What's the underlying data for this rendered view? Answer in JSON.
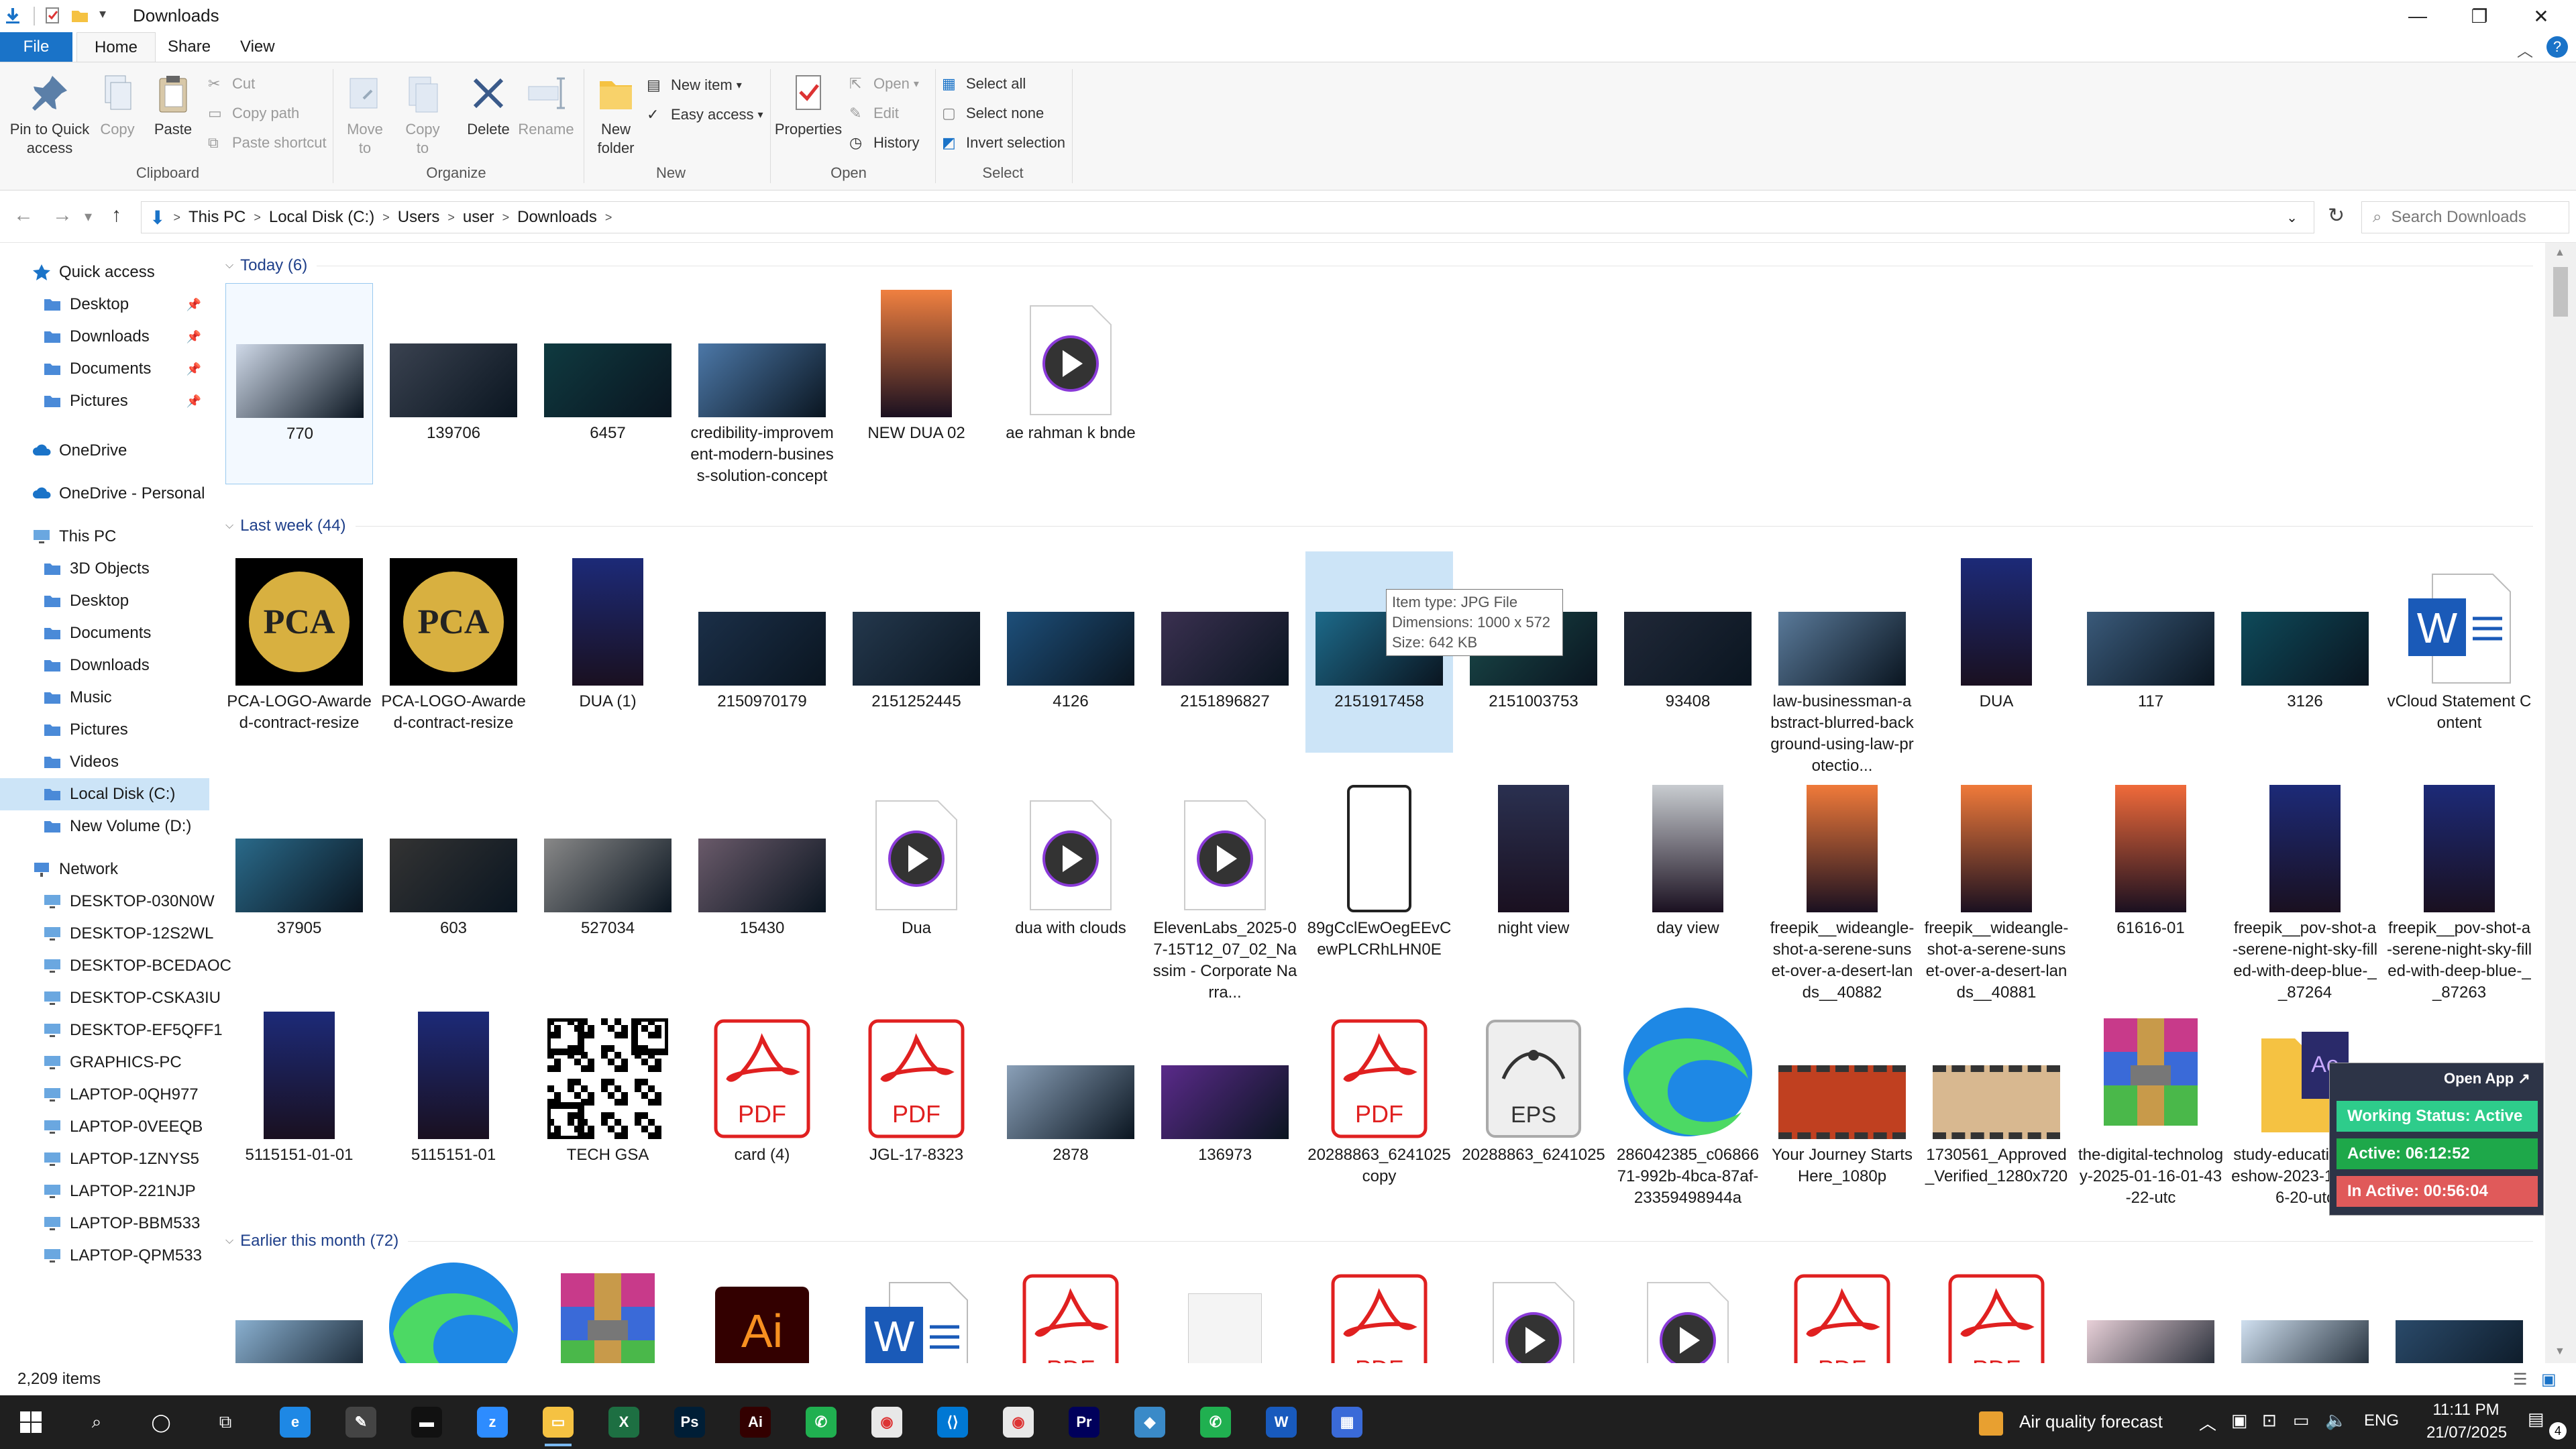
{
  "window": {
    "title": "Downloads"
  },
  "title_controls": {
    "minimize": "—",
    "maximize": "❐",
    "close": "✕"
  },
  "tabs": {
    "file": "File",
    "home": "Home",
    "share": "Share",
    "view": "View"
  },
  "ribbon": {
    "pin": "Pin to Quick access",
    "copy": "Copy",
    "paste": "Paste",
    "cut": "Cut",
    "copy_path": "Copy path",
    "paste_shortcut": "Paste shortcut",
    "move_to": "Move to",
    "copy_to": "Copy to",
    "delete": "Delete",
    "rename": "Rename",
    "new_folder": "New folder",
    "new_item": "New item",
    "easy_access": "Easy access",
    "properties": "Properties",
    "open": "Open",
    "edit": "Edit",
    "history": "History",
    "select_all": "Select all",
    "select_none": "Select none",
    "invert_selection": "Invert selection",
    "groups": {
      "clipboard": "Clipboard",
      "organize": "Organize",
      "new": "New",
      "open": "Open",
      "select": "Select"
    }
  },
  "address": {
    "crumbs": [
      "This PC",
      "Local Disk (C:)",
      "Users",
      "user",
      "Downloads"
    ],
    "sep": ">",
    "search_placeholder": "Search Downloads"
  },
  "nav": {
    "quick_access": "Quick access",
    "quick": [
      "Desktop",
      "Downloads",
      "Documents",
      "Pictures"
    ],
    "onedrive": "OneDrive",
    "onedrive_personal": "OneDrive - Personal",
    "this_pc": "This PC",
    "pc_items": [
      "3D Objects",
      "Desktop",
      "Documents",
      "Downloads",
      "Music",
      "Pictures",
      "Videos",
      "Local Disk (C:)",
      "New Volume (D:)"
    ],
    "network": "Network",
    "network_items": [
      "DESKTOP-030N0W",
      "DESKTOP-12S2WL",
      "DESKTOP-BCEDAOC",
      "DESKTOP-CSKA3IU",
      "DESKTOP-EF5QFF1",
      "GRAPHICS-PC",
      "LAPTOP-0QH977",
      "LAPTOP-0VEEQB",
      "LAPTOP-1ZNYS5",
      "LAPTOP-221NJP",
      "LAPTOP-BBM533",
      "LAPTOP-QPM533"
    ]
  },
  "groups": {
    "today": "Today (6)",
    "last_week": "Last week (44)",
    "earlier": "Earlier this month (72)"
  },
  "today_files": [
    {
      "name": "770",
      "kind": "photo",
      "color": "#cfd9e8"
    },
    {
      "name": "139706",
      "kind": "photo",
      "color": "#3a4250"
    },
    {
      "name": "6457",
      "kind": "photo",
      "color": "#0f3a40"
    },
    {
      "name": "credibility-improvement-modern-business-solution-concept",
      "kind": "photo",
      "color": "#4c78a8"
    },
    {
      "name": "NEW  DUA  02",
      "kind": "tall",
      "color": "#f08040"
    },
    {
      "name": "ae rahman k bnde",
      "kind": "video"
    }
  ],
  "week_row1": [
    {
      "name": "PCA-LOGO-Awarded-contract-resize",
      "kind": "pca"
    },
    {
      "name": "PCA-LOGO-Awarded-contract-resize",
      "kind": "pca"
    },
    {
      "name": "DUA  (1)",
      "kind": "tall",
      "color": "#1c2a78"
    },
    {
      "name": "2150970179",
      "kind": "photo",
      "color": "#1b2f48"
    },
    {
      "name": "2151252445",
      "kind": "photo",
      "color": "#24384d"
    },
    {
      "name": "4126",
      "kind": "photo",
      "color": "#1d4f7a"
    },
    {
      "name": "2151896827",
      "kind": "photo",
      "color": "#3a3050"
    },
    {
      "name": "2151917458",
      "kind": "photo",
      "color": "#1d6a8a"
    },
    {
      "name": "2151003753",
      "kind": "photo",
      "color": "#1a4a4a"
    },
    {
      "name": "93408",
      "kind": "photo",
      "color": "#202838"
    },
    {
      "name": "law-businessman-abstract-blurred-background-using-law-protectio...",
      "kind": "photo",
      "color": "#5a7a9a"
    },
    {
      "name": "DUA",
      "kind": "tall",
      "color": "#1c2a78"
    },
    {
      "name": "117",
      "kind": "photo",
      "color": "#3a5a7a"
    },
    {
      "name": "3126",
      "kind": "photo",
      "color": "#0e4a5a"
    },
    {
      "name": "vCloud Statement Content",
      "kind": "word"
    }
  ],
  "week_row2": [
    {
      "name": "37905",
      "kind": "photo",
      "color": "#2a6a8a"
    },
    {
      "name": "603",
      "kind": "photo",
      "color": "#333333"
    },
    {
      "name": "527034",
      "kind": "photo",
      "color": "#888888"
    },
    {
      "name": "15430",
      "kind": "photo",
      "color": "#6a5a6a"
    },
    {
      "name": "Dua",
      "kind": "video"
    },
    {
      "name": "dua with clouds",
      "kind": "video"
    },
    {
      "name": "ElevenLabs_2025-07-15T12_07_02_Nassim - Corporate Narra...",
      "kind": "video"
    },
    {
      "name": "89gCclEwOegEEvCewPLCRhLHN0E",
      "kind": "phone"
    },
    {
      "name": "night view",
      "kind": "tall",
      "color": "#2a3050"
    },
    {
      "name": "day view",
      "kind": "tall",
      "color": "#c8ccd0"
    },
    {
      "name": "freepik__wideangle-shot-a-serene-sunset-over-a-desert-lands__40882",
      "kind": "tall",
      "color": "#f07a3a"
    },
    {
      "name": "freepik__wideangle-shot-a-serene-sunset-over-a-desert-lands__40881",
      "kind": "tall",
      "color": "#f07a3a"
    },
    {
      "name": "61616-01",
      "kind": "tall",
      "color": "#f06a3a"
    },
    {
      "name": "freepik__pov-shot-a-serene-night-sky-filled-with-deep-blue-__87264",
      "kind": "tall",
      "color": "#1c2a78"
    },
    {
      "name": "freepik__pov-shot-a-serene-night-sky-filled-with-deep-blue-__87263",
      "kind": "tall",
      "color": "#1c2a78"
    }
  ],
  "week_row3": [
    {
      "name": "5115151-01-01",
      "kind": "tall",
      "color": "#1c2a78"
    },
    {
      "name": "5115151-01",
      "kind": "tall",
      "color": "#1c2a78"
    },
    {
      "name": "TECH GSA",
      "kind": "qr"
    },
    {
      "name": "card (4)",
      "kind": "pdf"
    },
    {
      "name": "JGL-17-8323",
      "kind": "pdf"
    },
    {
      "name": "2878",
      "kind": "photo",
      "color": "#8aa0b8"
    },
    {
      "name": "136973",
      "kind": "photo",
      "color": "#5a2a8a"
    },
    {
      "name": "20288863_6241025 copy",
      "kind": "pdf"
    },
    {
      "name": "20288863_6241025",
      "kind": "eps"
    },
    {
      "name": "2860423­85_c0686671-992b-4bca-87af-23359498944a",
      "kind": "edge"
    },
    {
      "name": "Your Journey Starts Here_1080p",
      "kind": "film",
      "color": "#c04020"
    },
    {
      "name": "1730561_Approved_Verified_1280x720",
      "kind": "film",
      "color": "#d8b890"
    },
    {
      "name": "the-digital-technology-2025-01-16-01-43-22-utc",
      "kind": "rar"
    },
    {
      "name": "study-education-slideshow-2023-11-07-06-20-utc",
      "kind": "aep"
    }
  ],
  "earlier_files": [
    {
      "kind": "photo",
      "color": "#8ab0d0"
    },
    {
      "kind": "edge"
    },
    {
      "kind": "rar"
    },
    {
      "kind": "ai"
    },
    {
      "kind": "word"
    },
    {
      "kind": "pdf"
    },
    {
      "kind": "doc"
    },
    {
      "kind": "pdf"
    },
    {
      "kind": "video"
    },
    {
      "kind": "video"
    },
    {
      "kind": "pdf"
    },
    {
      "kind": "pdf"
    },
    {
      "kind": "photo",
      "color": "#e8d0d8"
    },
    {
      "kind": "photo",
      "color": "#d0e0f0"
    },
    {
      "kind": "photo",
      "color": "#2a4a6a"
    }
  ],
  "tooltip": {
    "type": "Item type: JPG File",
    "dims": "Dimensions: 1000 x 572",
    "size": "Size: 642 KB"
  },
  "widget": {
    "open_app": "Open App ↗",
    "status": "Working Status: Active",
    "active": "Active: 06:12:52",
    "inactive": "In Active: 00:56:04",
    "colors": {
      "status": "#2ecc8b",
      "active": "#1ea84a",
      "inactive": "#e05a5a"
    }
  },
  "statusbar": {
    "count": "2,209 items"
  },
  "taskbar": {
    "weather": "Air quality forecast",
    "lang": "ENG",
    "time": "11:11 PM",
    "date": "21/07/2025",
    "notifications": "4"
  }
}
